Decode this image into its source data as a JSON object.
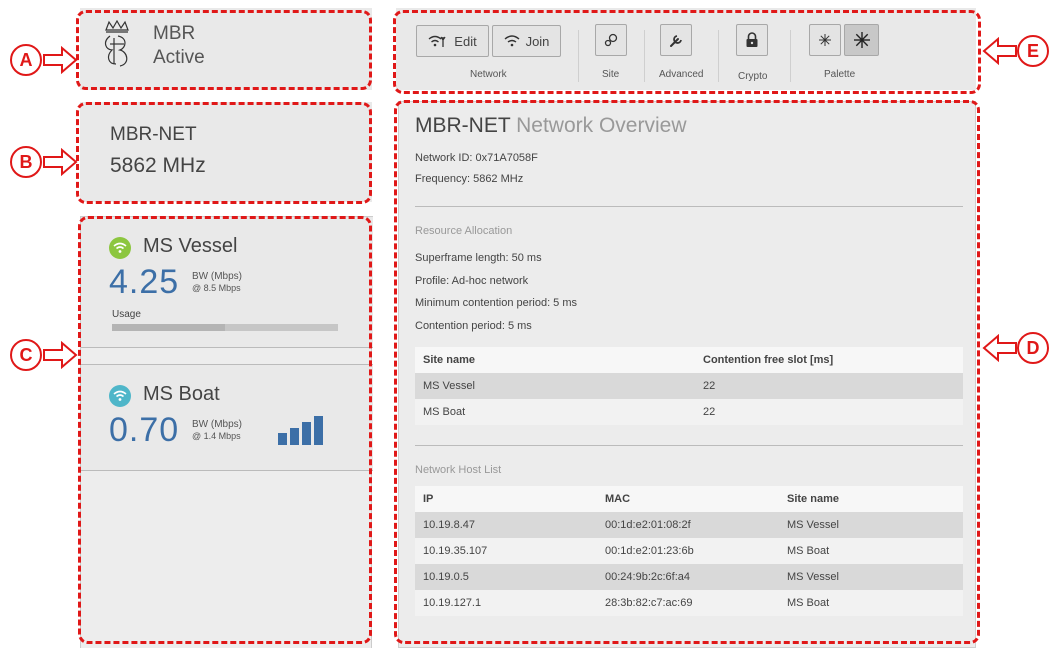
{
  "device": {
    "name": "MBR",
    "status": "Active",
    "crest_icon": "royal-crest-icon"
  },
  "network": {
    "name": "MBR-NET",
    "frequency": "5862 MHz"
  },
  "sites": [
    {
      "name": "MS Vessel",
      "bw": "4.25",
      "bw_label": "BW (Mbps)",
      "bw_at": "@ 8.5 Mbps",
      "usage_label": "Usage",
      "usage_fraction": 0.5,
      "indicator_color": "#8cc63f",
      "icon": "wifi-icon"
    },
    {
      "name": "MS Boat",
      "bw": "0.70",
      "bw_label": "BW (Mbps)",
      "bw_at": "@ 1.4 Mbps",
      "signal_bars": 4,
      "indicator_color": "#4fb6c9",
      "icon": "wifi-icon"
    }
  ],
  "toolbar": {
    "network_group": {
      "caption": "Network",
      "edit_label": "Edit",
      "join_label": "Join"
    },
    "site_caption": "Site",
    "advanced_caption": "Advanced",
    "crypto_caption": "Crypto",
    "palette_caption": "Palette"
  },
  "overview": {
    "title_strong": "MBR-NET",
    "title_light": "Network Overview",
    "network_id": "Network ID: 0x71A7058F",
    "frequency": "Frequency: 5862 MHz",
    "resource_heading": "Resource Allocation",
    "superframe": "Superframe length: 50 ms",
    "profile": "Profile: Ad-hoc network",
    "min_contention": "Minimum contention period: 5 ms",
    "contention": "Contention period: 5 ms",
    "slots_table": {
      "headers": [
        "Site name",
        "Contention free slot [ms]"
      ],
      "rows": [
        [
          "MS Vessel",
          "22"
        ],
        [
          "MS Boat",
          "22"
        ]
      ]
    },
    "host_heading": "Network Host List",
    "host_table": {
      "headers": [
        "IP",
        "MAC",
        "Site name"
      ],
      "rows": [
        [
          "10.19.8.47",
          "00:1d:e2:01:08:2f",
          "MS Vessel"
        ],
        [
          "10.19.35.107",
          "00:1d:e2:01:23:6b",
          "MS Boat"
        ],
        [
          "10.19.0.5",
          "00:24:9b:2c:6f:a4",
          "MS Vessel"
        ],
        [
          "10.19.127.1",
          "28:3b:82:c7:ac:69",
          "MS Boat"
        ]
      ]
    }
  },
  "markers": {
    "a": "A",
    "b": "B",
    "c": "C",
    "d": "D",
    "e": "E"
  },
  "colors": {
    "annotation": "#e01818",
    "bw_value": "#3c6fa7",
    "panel": "#e9e9e9"
  }
}
